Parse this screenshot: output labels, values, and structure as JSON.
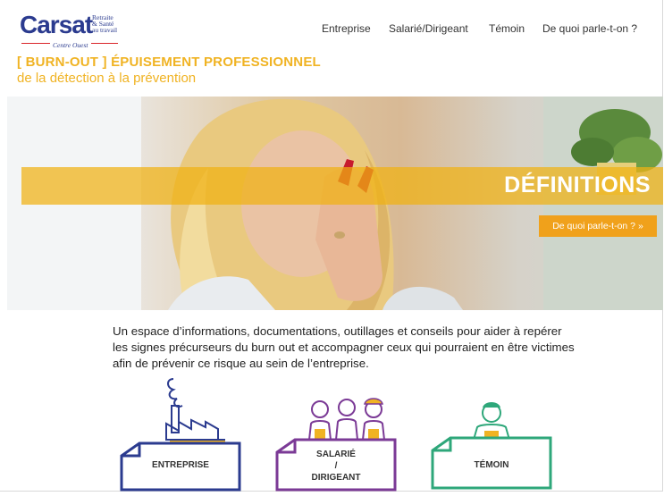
{
  "logo": {
    "word": "Carsat",
    "tagline": [
      "Retraite",
      "& Santé",
      "au travail"
    ],
    "sub": "Centre Ouest"
  },
  "nav": [
    "Entreprise",
    "Salarié/Dirigeant",
    "Témoin",
    "De quoi parle-t-on ?"
  ],
  "title": "[ BURN-OUT ] ÉPUISEMENT PROFESSIONNEL",
  "subtitle": "de la détection à la prévention",
  "hero": {
    "band_title": "DÉFINITIONS",
    "button": "De quoi parle-t-on ? »"
  },
  "intro": "Un espace d’informations, documentations, outillages et conseils pour aider à repérer les signes précurseurs du burn out et accompagner ceux qui pourraient en être victimes afin de prévenir ce risque au sein de l’entreprise.",
  "cards": [
    {
      "label": "ENTREPRISE",
      "color": "#2b3b8f"
    },
    {
      "label_lines": [
        "SALARIÉ",
        "/",
        "DIRIGEANT"
      ],
      "color": "#7b3a96"
    },
    {
      "label": "TÉMOIN",
      "color": "#2ea77a"
    }
  ],
  "colors": {
    "accent": "#f0b323",
    "button": "#f0a11b",
    "brand": "#2b3b8f"
  }
}
